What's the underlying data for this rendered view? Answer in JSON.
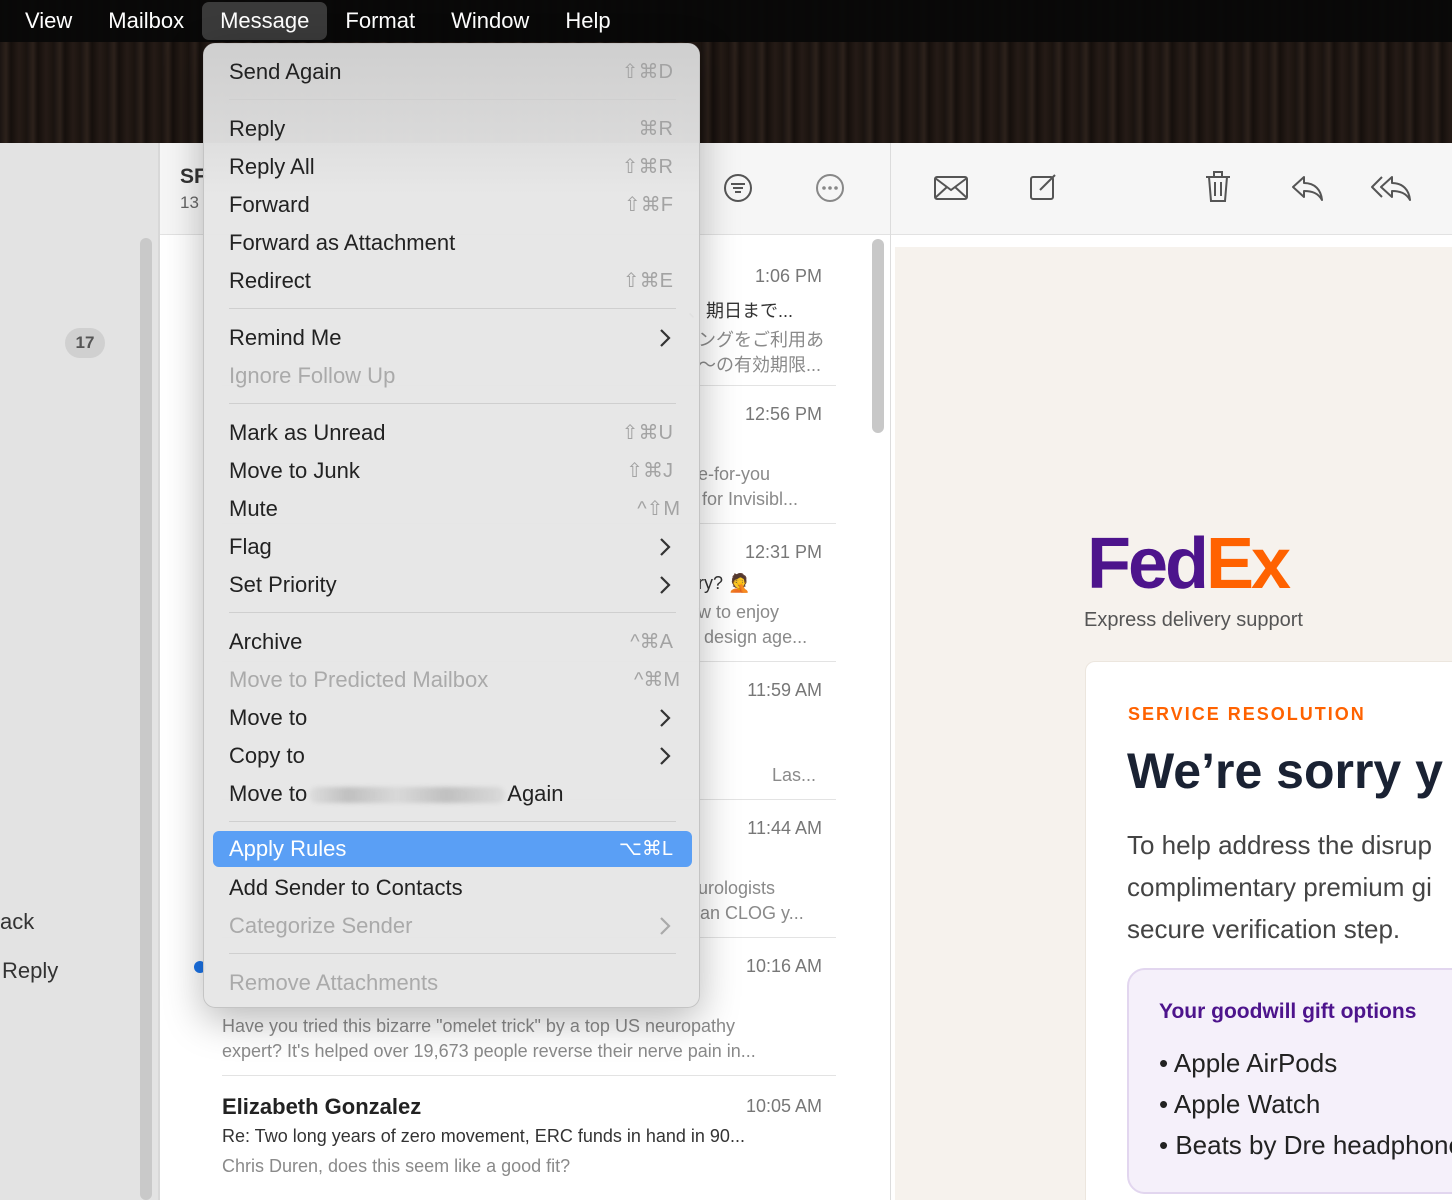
{
  "menubar": {
    "items": [
      "View",
      "Mailbox",
      "Message",
      "Format",
      "Window",
      "Help"
    ],
    "active": "Message"
  },
  "sidebar": {
    "badge": "17",
    "back_label": "ack",
    "reply_label": "Reply"
  },
  "mail_list": {
    "mailbox_title": "SF",
    "mailbox_count": "13",
    "rows": [
      {
        "time": "1:06 PM",
        "line1": "、期日まで...",
        "line2": "ングをご利用あ",
        "line3": "～の有効期限..."
      },
      {
        "time": "12:56 PM",
        "line1": "e-for-you",
        "line2": "for Invisibl..."
      },
      {
        "time": "12:31 PM",
        "line1": "ry? 🤦",
        "line2": "w to enjoy",
        "line3": "design age..."
      },
      {
        "time": "11:59 AM",
        "line1": "Las..."
      },
      {
        "time": "11:44 AM",
        "line1": "urologists",
        "line2": "an CLOG y..."
      },
      {
        "time": "10:16 AM",
        "line1": "Have you tried this bizarre \"omelet trick\" by a top US neuropathy",
        "line2": "expert? It's helped over 19,673 people reverse their nerve pain in..."
      },
      {
        "sender": "Elizabeth Gonzalez",
        "time": "10:05 AM",
        "line1": "Re: Two long years of zero movement, ERC funds in hand in 90...",
        "line2": "Chris Duren, does this seem like a good fit?"
      }
    ]
  },
  "message_menu": {
    "items": [
      {
        "label": "Send Again",
        "shortcut": "⇧⌘D"
      },
      {
        "label": "Reply",
        "shortcut": "⌘R"
      },
      {
        "label": "Reply All",
        "shortcut": "⇧⌘R"
      },
      {
        "label": "Forward",
        "shortcut": "⇧⌘F"
      },
      {
        "label": "Forward as Attachment",
        "shortcut": ""
      },
      {
        "label": "Redirect",
        "shortcut": "⇧⌘E"
      },
      {
        "label": "Remind Me",
        "shortcut": ""
      },
      {
        "label": "Ignore Follow Up",
        "shortcut": ""
      },
      {
        "label": "Mark as Unread",
        "shortcut": "⇧⌘U"
      },
      {
        "label": "Move to Junk",
        "shortcut": "⇧⌘J"
      },
      {
        "label": "Mute",
        "shortcut": "^⇧M"
      },
      {
        "label": "Flag",
        "shortcut": ""
      },
      {
        "label": "Set Priority",
        "shortcut": ""
      },
      {
        "label": "Archive",
        "shortcut": "^⌘A"
      },
      {
        "label": "Move to Predicted Mailbox",
        "shortcut": "^⌘M"
      },
      {
        "label": "Move to",
        "shortcut": ""
      },
      {
        "label": "Copy to",
        "shortcut": ""
      },
      {
        "label_prefix": "Move to",
        "label_suffix": "Again"
      },
      {
        "label": "Apply Rules",
        "shortcut": "⌥⌘L"
      },
      {
        "label": "Add Sender to Contacts",
        "shortcut": ""
      },
      {
        "label": "Categorize Sender",
        "shortcut": ""
      },
      {
        "label": "Remove Attachments",
        "shortcut": ""
      }
    ]
  },
  "email": {
    "logo_left": "Fed",
    "logo_right": "Ex",
    "tagline": "Express delivery support",
    "eyebrow": "SERVICE RESOLUTION",
    "headline": "We’re sorry y",
    "body_lines": [
      "To help address the disrup",
      "complimentary premium gi",
      "secure verification step."
    ],
    "gift_title": "Your goodwill gift options",
    "gift_items": [
      "• Apple AirPods",
      "• Apple Watch",
      "• Beats by Dre headphone"
    ]
  },
  "colors": {
    "fedex_purple": "#4d148c",
    "fedex_orange": "#ff6200",
    "menu_highlight": "#5a9ff5",
    "unread_dot": "#1a73e8"
  }
}
